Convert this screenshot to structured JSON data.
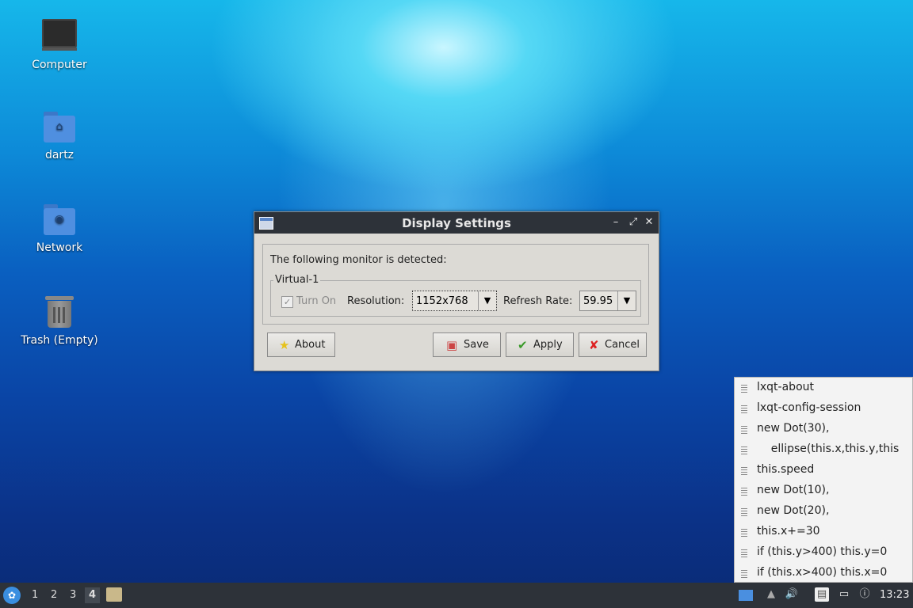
{
  "desktop": {
    "icons": [
      {
        "label": "Computer"
      },
      {
        "label": "dartz"
      },
      {
        "label": "Network"
      },
      {
        "label": "Trash (Empty)"
      }
    ]
  },
  "dialog": {
    "title": "Display Settings",
    "detected_text": "The following monitor is detected:",
    "monitor_name": "Virtual-1",
    "turn_on_label": "Turn On",
    "resolution_label": "Resolution:",
    "resolution_value": "1152x768",
    "refresh_label": "Refresh Rate:",
    "refresh_value": "59.95",
    "buttons": {
      "about": "About",
      "save": "Save",
      "apply": "Apply",
      "cancel": "Cancel"
    }
  },
  "menu": {
    "items": [
      {
        "label": "lxqt-about"
      },
      {
        "label": "lxqt-config-session"
      },
      {
        "label": "new Dot(30),"
      },
      {
        "label": "    ellipse(this.x,this.y,this"
      },
      {
        "label": "this.speed"
      },
      {
        "label": "new Dot(10),"
      },
      {
        "label": "new Dot(20),"
      },
      {
        "label": "this.x+=30"
      },
      {
        "label": "if (this.y>400) this.y=0"
      },
      {
        "label": "if (this.x>400) this.x=0"
      }
    ]
  },
  "taskbar": {
    "workspaces": [
      "1",
      "2",
      "3",
      "4"
    ],
    "active_workspace": "4",
    "clock": "13:23"
  }
}
